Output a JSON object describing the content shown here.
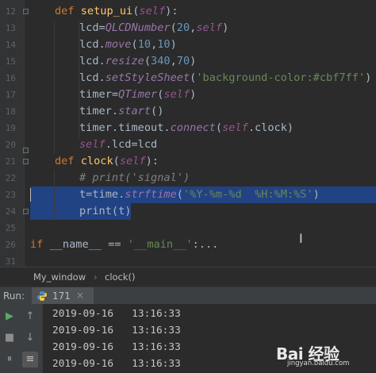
{
  "editor": {
    "lines": [
      {
        "n": "12",
        "indent": 1,
        "tokens": [
          [
            "kw",
            "def "
          ],
          [
            "fn",
            "setup_ui"
          ],
          [
            "plain",
            "("
          ],
          [
            "self",
            "self"
          ],
          [
            "plain",
            "):"
          ]
        ]
      },
      {
        "n": "13",
        "indent": 2,
        "tokens": [
          [
            "plain",
            "lcd="
          ],
          [
            "it",
            "QLCDNumber"
          ],
          [
            "plain",
            "("
          ],
          [
            "num",
            "20"
          ],
          [
            "plain",
            ","
          ],
          [
            "self",
            "self"
          ],
          [
            "plain",
            ")"
          ]
        ]
      },
      {
        "n": "14",
        "indent": 2,
        "tokens": [
          [
            "plain",
            "lcd."
          ],
          [
            "it",
            "move"
          ],
          [
            "plain",
            "("
          ],
          [
            "num",
            "10"
          ],
          [
            "plain",
            ","
          ],
          [
            "num",
            "10"
          ],
          [
            "plain",
            ")"
          ]
        ]
      },
      {
        "n": "15",
        "indent": 2,
        "tokens": [
          [
            "plain",
            "lcd."
          ],
          [
            "it",
            "resize"
          ],
          [
            "plain",
            "("
          ],
          [
            "num",
            "340"
          ],
          [
            "plain",
            ","
          ],
          [
            "num",
            "70"
          ],
          [
            "plain",
            ")"
          ]
        ]
      },
      {
        "n": "16",
        "indent": 2,
        "tokens": [
          [
            "plain",
            "lcd."
          ],
          [
            "it",
            "setStyleSheet"
          ],
          [
            "plain",
            "("
          ],
          [
            "str",
            "'background-color:#cbf7ff'"
          ],
          [
            "plain",
            ")"
          ]
        ]
      },
      {
        "n": "17",
        "indent": 2,
        "tokens": [
          [
            "plain",
            "timer="
          ],
          [
            "it",
            "QTimer"
          ],
          [
            "plain",
            "("
          ],
          [
            "self",
            "self"
          ],
          [
            "plain",
            ")"
          ]
        ]
      },
      {
        "n": "18",
        "indent": 2,
        "tokens": [
          [
            "plain",
            "timer."
          ],
          [
            "it",
            "start"
          ],
          [
            "plain",
            "()"
          ]
        ]
      },
      {
        "n": "19",
        "indent": 2,
        "tokens": [
          [
            "plain",
            "timer.timeout."
          ],
          [
            "it",
            "connect"
          ],
          [
            "plain",
            "("
          ],
          [
            "self",
            "self"
          ],
          [
            "plain",
            ".clock)"
          ]
        ]
      },
      {
        "n": "20",
        "indent": 2,
        "tokens": [
          [
            "self",
            "self"
          ],
          [
            "plain",
            ".lcd=lcd"
          ]
        ]
      },
      {
        "n": "21",
        "indent": 1,
        "tokens": [
          [
            "kw",
            "def "
          ],
          [
            "fn",
            "clock"
          ],
          [
            "plain",
            "("
          ],
          [
            "self",
            "self"
          ],
          [
            "plain",
            "):"
          ]
        ]
      },
      {
        "n": "22",
        "indent": 2,
        "tokens": [
          [
            "cm",
            "# print('signal')"
          ]
        ]
      },
      {
        "n": "23",
        "indent": 2,
        "selected": true,
        "tokens": [
          [
            "plain",
            "t=time."
          ],
          [
            "it",
            "strftime"
          ],
          [
            "plain",
            "("
          ],
          [
            "str",
            "'%Y-%m-%d  %H:%M:%S'"
          ],
          [
            "plain",
            ")"
          ]
        ]
      },
      {
        "n": "24",
        "indent": 2,
        "selected": true,
        "tokens": [
          [
            "plain",
            "print(t)"
          ]
        ]
      },
      {
        "n": "25",
        "indent": 0,
        "tokens": []
      },
      {
        "n": "26",
        "indent": 0,
        "tokens": [
          [
            "kw",
            "if "
          ],
          [
            "plain",
            "__name__ == "
          ],
          [
            "str",
            "'__main__'"
          ],
          [
            "plain",
            ":..."
          ]
        ]
      },
      {
        "n": "31",
        "indent": 0,
        "tokens": []
      }
    ]
  },
  "breadcrumb": {
    "class_name": "My_window",
    "sep": "›",
    "method": "clock()"
  },
  "run": {
    "label": "Run:",
    "tab_name": "171",
    "close": "×"
  },
  "console": {
    "lines": [
      "2019-09-16   13:16:33",
      "2019-09-16   13:16:33",
      "2019-09-16   13:16:33",
      "2019-09-16   13:16:33"
    ]
  },
  "watermark": {
    "main": "Bai 经验",
    "sub": "jingyan.baidu.com"
  },
  "colors": {
    "bg": "#2b2b2b",
    "keyword": "#cc7832",
    "function": "#ffc66d",
    "string": "#6a8759",
    "number": "#6897bb",
    "selection": "#214283"
  }
}
